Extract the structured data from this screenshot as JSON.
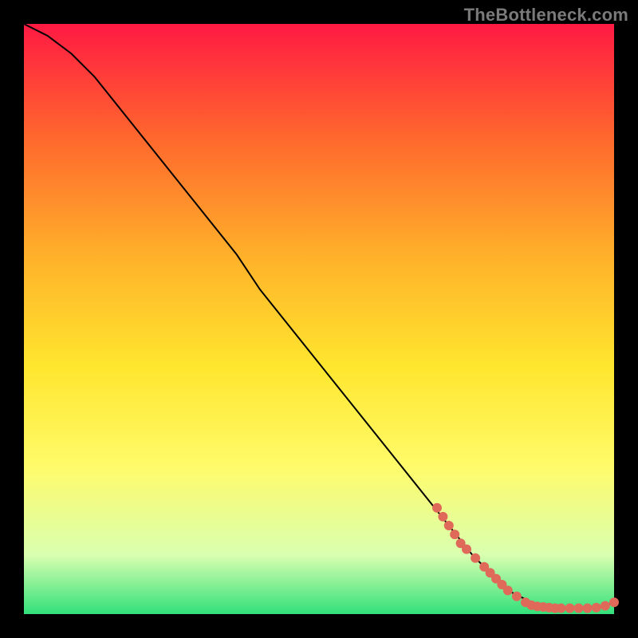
{
  "watermark": "TheBottleneck.com",
  "colors": {
    "gradient_stops": [
      "#ff1a43",
      "#ff6a2d",
      "#ffb32a",
      "#ffe62e",
      "#fffb6a",
      "#d9ffb0",
      "#32e07a"
    ],
    "curve_stroke": "#000000",
    "marker_fill": "#e06a5a",
    "marker_stroke": "#c94f3f",
    "background": "#000000"
  },
  "chart_data": {
    "type": "line",
    "title": "",
    "xlabel": "",
    "ylabel": "",
    "xlim": [
      0,
      100
    ],
    "ylim": [
      0,
      100
    ],
    "series": [
      {
        "name": "curve",
        "x": [
          0,
          4,
          8,
          12,
          16,
          20,
          24,
          28,
          32,
          36,
          40,
          44,
          48,
          52,
          56,
          60,
          64,
          68,
          72,
          76,
          80,
          82,
          84,
          86,
          88,
          90,
          92,
          94,
          96,
          98,
          100
        ],
        "y": [
          100,
          98,
          95,
          91,
          86,
          81,
          76,
          71,
          66,
          61,
          55,
          50,
          45,
          40,
          35,
          30,
          25,
          20,
          15,
          10,
          6,
          4,
          3,
          2,
          1.5,
          1.2,
          1.0,
          1.0,
          1.0,
          1.3,
          2.0
        ]
      }
    ],
    "markers": [
      {
        "x": 70,
        "y": 18
      },
      {
        "x": 71,
        "y": 16.5
      },
      {
        "x": 72,
        "y": 15
      },
      {
        "x": 73,
        "y": 13.5
      },
      {
        "x": 74,
        "y": 12
      },
      {
        "x": 75,
        "y": 11
      },
      {
        "x": 76.5,
        "y": 9.5
      },
      {
        "x": 78,
        "y": 8
      },
      {
        "x": 79,
        "y": 7
      },
      {
        "x": 80,
        "y": 6
      },
      {
        "x": 81,
        "y": 5
      },
      {
        "x": 82,
        "y": 4
      },
      {
        "x": 83.5,
        "y": 3
      },
      {
        "x": 85,
        "y": 2
      },
      {
        "x": 86,
        "y": 1.5
      },
      {
        "x": 87,
        "y": 1.3
      },
      {
        "x": 88,
        "y": 1.2
      },
      {
        "x": 89,
        "y": 1.1
      },
      {
        "x": 90,
        "y": 1.0
      },
      {
        "x": 91,
        "y": 1.0
      },
      {
        "x": 92.5,
        "y": 1.0
      },
      {
        "x": 94,
        "y": 1.0
      },
      {
        "x": 95.5,
        "y": 1.0
      },
      {
        "x": 97,
        "y": 1.1
      },
      {
        "x": 98.5,
        "y": 1.4
      },
      {
        "x": 100,
        "y": 2.0
      }
    ]
  }
}
